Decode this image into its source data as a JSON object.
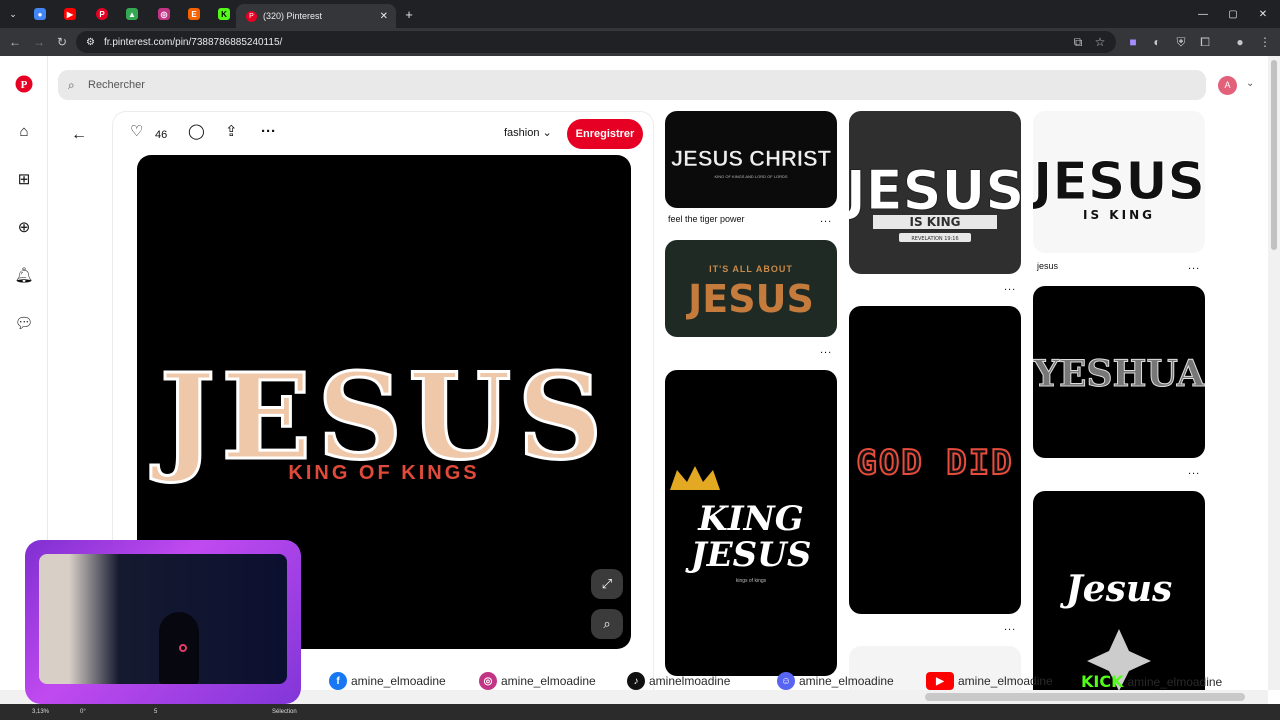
{
  "browser": {
    "tabs": [
      {
        "icon": "chrome-icon",
        "color": "#4285f4"
      },
      {
        "icon": "youtube-icon",
        "color": "#ff0000"
      },
      {
        "icon": "pinterest-icon",
        "color": "#e60023"
      },
      {
        "icon": "drive-icon",
        "color": "#34a853"
      },
      {
        "icon": "instagram-icon",
        "color": "#c13584"
      },
      {
        "icon": "etsy-icon",
        "color": "#f56400"
      },
      {
        "icon": "kick-icon",
        "color": "#53fc18"
      }
    ],
    "active_tab_title": "(320) Pinterest",
    "new_tab": "+",
    "url": "fr.pinterest.com/pin/738878688524011​5/"
  },
  "pinterest": {
    "search_placeholder": "Rechercher",
    "avatar_initial": "A",
    "closeup": {
      "likes": "46",
      "board": "fashion",
      "save_label": "Enregistrer",
      "image_title": "JESUS",
      "image_subtitle": "KING OF KINGS"
    },
    "grid": [
      {
        "art": "JESUS CHRIST",
        "sub": "KING OF KINGS AND LORD OF LORDS",
        "caption": "feel the tiger power",
        "more": "..."
      },
      {
        "art": "JESUS",
        "sub": "IT'S ALL ABOUT",
        "caption": "",
        "more": "..."
      },
      {
        "art": "KING JESUS",
        "sub": "kings of kings",
        "caption": "",
        "more": ""
      },
      {
        "art": "JESUS",
        "sub": "IS KING",
        "sub2": "REVELATION 19:16",
        "caption": "",
        "more": "..."
      },
      {
        "art": "GOD DID",
        "caption": "",
        "more": "..."
      },
      {
        "art": "JESUS",
        "sub": "IS KING",
        "caption": "jesus",
        "more": "..."
      },
      {
        "art": "YESHUA",
        "caption": "",
        "more": "..."
      },
      {
        "art": "Jesus",
        "caption": "",
        "more": ""
      }
    ]
  },
  "overlay": {
    "social": [
      {
        "handle": "amine_elmoadine",
        "color": "#1877f2",
        "icon": "facebook-icon",
        "glyph": "f"
      },
      {
        "handle": "amine_elmoadine",
        "color": "#c13584",
        "icon": "instagram-icon",
        "glyph": "◎"
      },
      {
        "handle": "aminelmoadine",
        "color": "#111111",
        "icon": "tiktok-icon",
        "glyph": "♪"
      },
      {
        "handle": "amine_elmoadine",
        "color": "#5865f2",
        "icon": "discord-icon",
        "glyph": "☺"
      },
      {
        "handle": "amine_elmoadine",
        "color": "#ff0000",
        "icon": "youtube-icon",
        "glyph": "▶"
      },
      {
        "handle": "amine_elmoadine",
        "color": "#53fc18",
        "icon": "kick-icon",
        "glyph": "KICK"
      }
    ],
    "taskbar_zoom": "3,13%",
    "taskbar_angle": "0°",
    "taskbar_page": "5",
    "taskbar_mode": "Sélection"
  }
}
